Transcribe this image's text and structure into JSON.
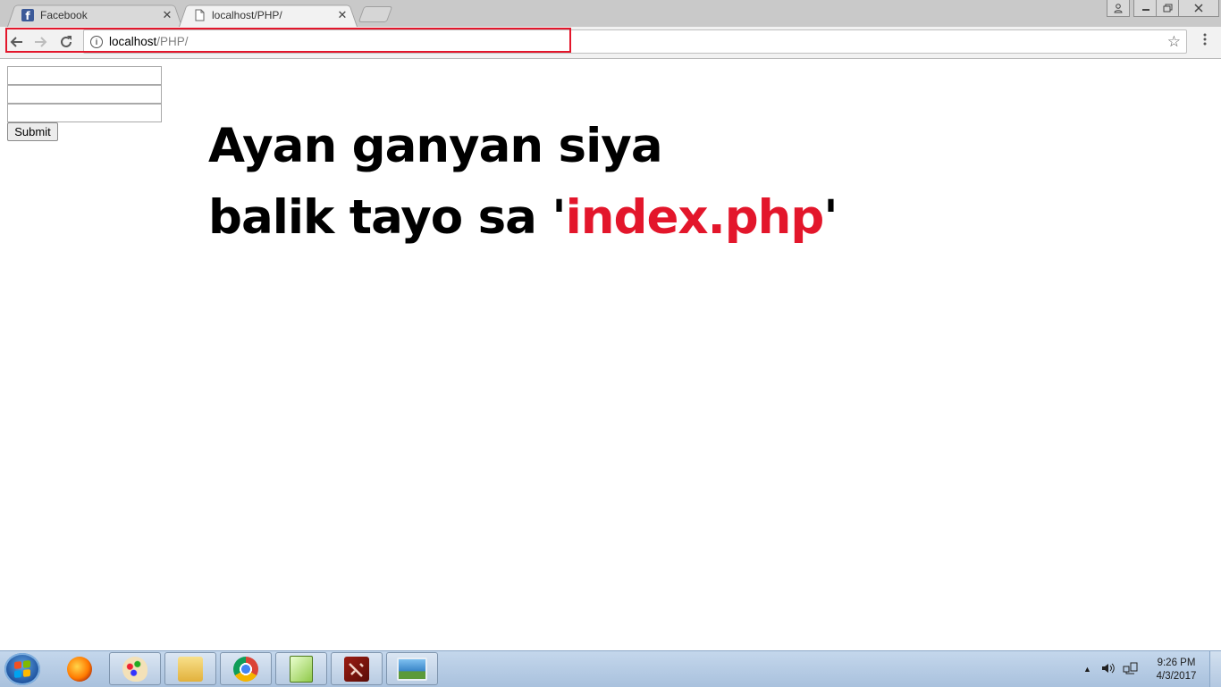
{
  "tabs": [
    {
      "title": "Facebook",
      "icon": "facebook-icon",
      "active": false
    },
    {
      "title": "localhost/PHP/",
      "icon": "page-icon",
      "active": true
    }
  ],
  "tab_close_glyph": "✕",
  "address_bar": {
    "host": "localhost",
    "path": "/PHP/",
    "highlight_color": "#e3162b"
  },
  "form": {
    "field_1": "",
    "field_2": "",
    "field_3": "",
    "submit_label": "Submit"
  },
  "message": {
    "line1": "Ayan ganyan siya",
    "line2_prefix": "balik tayo sa '",
    "line2_highlight": "index.php",
    "line2_suffix": "'",
    "highlight_color": "#e3162b"
  },
  "taskbar": {
    "apps": [
      "firefox-icon",
      "paint-icon",
      "file-explorer-icon",
      "chrome-icon",
      "notepad-plus-plus-icon",
      "dota-icon",
      "photo-viewer-icon"
    ],
    "clock_time": "9:26 PM",
    "clock_date": "4/3/2017"
  }
}
